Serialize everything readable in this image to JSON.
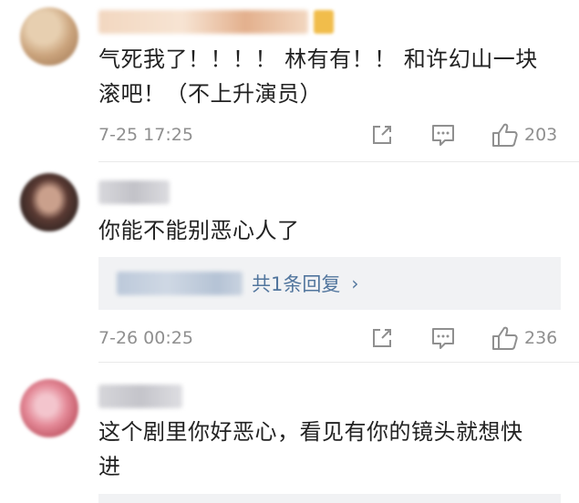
{
  "comments": [
    {
      "text_lines": [
        "气死我了！！！！ 林有有！！ 和许幻山一块",
        "滚吧！（不上升演员）"
      ],
      "timestamp": "7-25 17:25",
      "likes": "203",
      "avatar_colors": [
        "#caa37c",
        "#e7cfb0",
        "#9c7350"
      ],
      "name_colors": [
        "#f2d7c0",
        "#e3b08d"
      ]
    },
    {
      "text_lines": [
        "你能不能别恶心人了"
      ],
      "timestamp": "7-26 00:25",
      "likes": "236",
      "avatar_colors": [
        "#3b2a26",
        "#caa08c",
        "#5a3a33"
      ],
      "name_colors": [
        "#d8d8dc",
        "#c2c2c8"
      ],
      "reply": {
        "label": "共1条回复",
        "chevron": "›"
      }
    },
    {
      "text_lines": [
        "这个剧里你好恶心，看见有你的镜头就想快",
        "进"
      ],
      "avatar_colors": [
        "#e48a98",
        "#f3c5cd",
        "#c8616f"
      ],
      "name_colors": [
        "#d6d6da",
        "#c4c4ca"
      ]
    }
  ],
  "icons": {
    "repost": "repost-icon",
    "comment": "comment-icon",
    "like": "thumbs-up-icon"
  },
  "colors": {
    "meta_gray": "#8f8f8f",
    "reply_link": "#51759d",
    "reply_bg": "#f1f2f4",
    "vip_badge": "#f1bd4b"
  }
}
